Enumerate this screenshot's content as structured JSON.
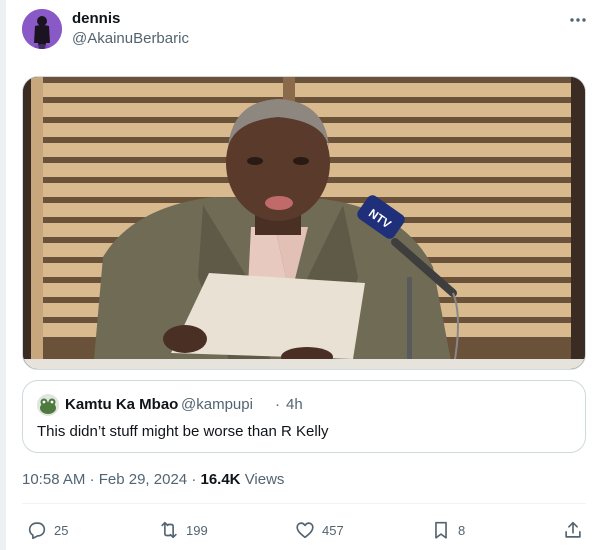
{
  "author": {
    "display_name": "dennis",
    "handle": "@AkainuBerbaric"
  },
  "more_icon": "more-horizontal-icon",
  "media": {
    "mic_logo": "NTV"
  },
  "quote": {
    "display_name": "Kamtu Ka Mbao",
    "handle": "@kampupi",
    "separator": "·",
    "time": "4h",
    "text": "This didn’t stuff might be worse than R Kelly"
  },
  "meta": {
    "time": "10:58 AM",
    "separator": "·",
    "date": "Feb 29, 2024",
    "separator2": "·",
    "views_count": "16.4K",
    "views_label": "Views"
  },
  "actions": {
    "replies": "25",
    "reposts": "199",
    "likes": "457",
    "bookmarks": "8"
  },
  "colors": {
    "text_primary": "#0f1419",
    "text_secondary": "#536471",
    "border": "#cfd9de",
    "avatar_bg": "#8a59c8"
  }
}
